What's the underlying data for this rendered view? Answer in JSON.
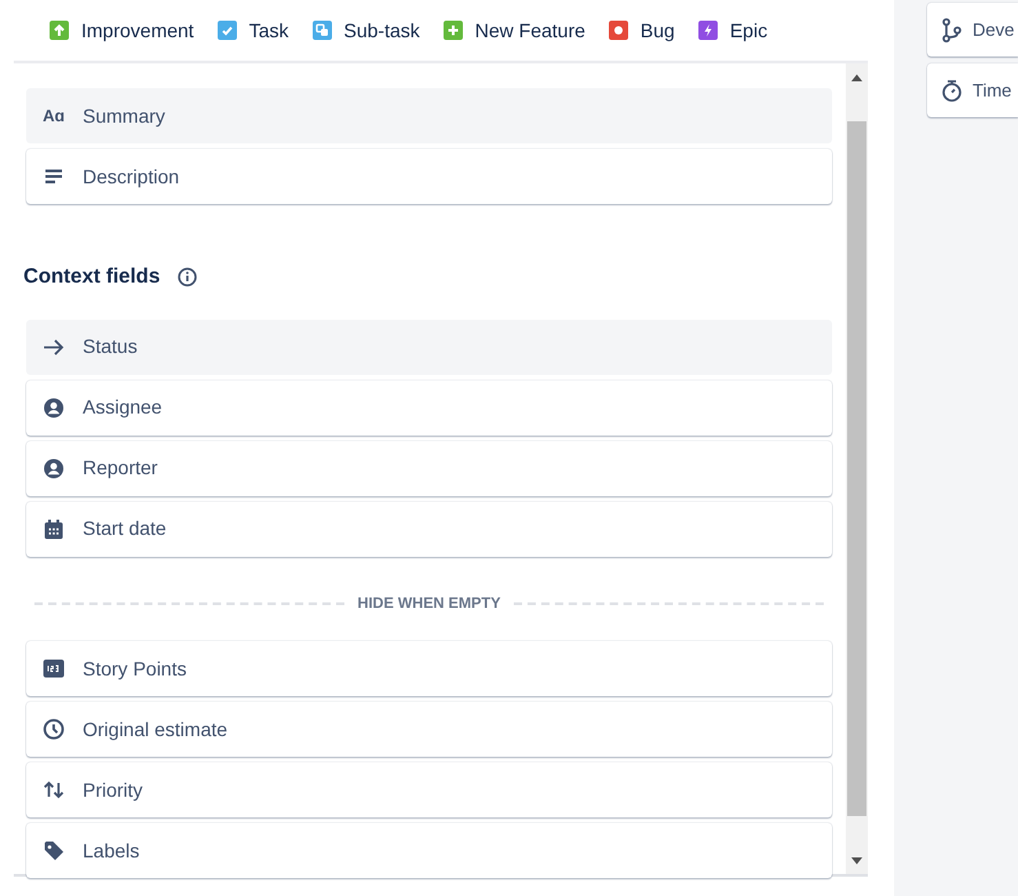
{
  "issue_types": [
    {
      "label": "Improvement",
      "kind": "improvement",
      "color": "#63ba3c"
    },
    {
      "label": "Task",
      "kind": "task",
      "color": "#4bade8"
    },
    {
      "label": "Sub-task",
      "kind": "subtask",
      "color": "#4bade8"
    },
    {
      "label": "New Feature",
      "kind": "feature",
      "color": "#63ba3c"
    },
    {
      "label": "Bug",
      "kind": "bug",
      "color": "#e5493a"
    },
    {
      "label": "Epic",
      "kind": "epic",
      "color": "#904ee2"
    }
  ],
  "description_fields": [
    {
      "label": "Summary",
      "kind": "text",
      "glyph": "Aɑ",
      "locked": true
    },
    {
      "label": "Description",
      "kind": "lines",
      "locked": false
    }
  ],
  "context_heading": "Context fields",
  "context_fields": [
    {
      "label": "Status",
      "kind": "arrow",
      "locked": true
    },
    {
      "label": "Assignee",
      "kind": "person",
      "locked": false
    },
    {
      "label": "Reporter",
      "kind": "person",
      "locked": false
    },
    {
      "label": "Start date",
      "kind": "calendar",
      "locked": false
    }
  ],
  "divider_label": "HIDE WHEN EMPTY",
  "hidden_fields": [
    {
      "label": "Story Points",
      "kind": "number",
      "locked": false
    },
    {
      "label": "Original estimate",
      "kind": "clock",
      "locked": false
    },
    {
      "label": "Priority",
      "kind": "updown",
      "locked": false
    },
    {
      "label": "Labels",
      "kind": "tag",
      "locked": false
    }
  ],
  "side_cards": [
    {
      "label": "Deve",
      "kind": "branch"
    },
    {
      "label": "Time",
      "kind": "stopwatch"
    }
  ]
}
